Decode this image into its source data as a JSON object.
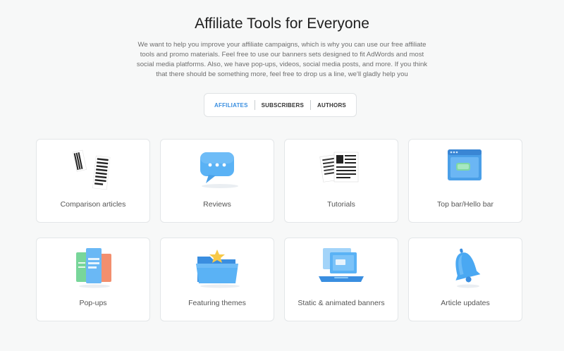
{
  "header": {
    "title": "Affiliate Tools for Everyone",
    "description": "We want to help you improve your affiliate campaigns, which is why you can use our free affiliate tools and promo materials. Feel free to use our banners sets designed to fit AdWords and most social media platforms. Also, we have pop-ups, videos, social media posts, and more. If you think that there should be something more, feel free to drop us a line, we'll gladly help you"
  },
  "tabs": [
    {
      "label": "AFFILIATES",
      "active": true
    },
    {
      "label": "SUBSCRIBERS",
      "active": false
    },
    {
      "label": "AUTHORS",
      "active": false
    }
  ],
  "colors": {
    "accent": "#3a8fe0",
    "icon_blue": "#4aa8f2",
    "background": "#f7f8f8"
  },
  "tools": [
    {
      "label": "Comparison articles",
      "icon": "comparison-articles-icon"
    },
    {
      "label": "Reviews",
      "icon": "chat-bubble-icon"
    },
    {
      "label": "Tutorials",
      "icon": "newspaper-icon"
    },
    {
      "label": "Top bar/Hello bar",
      "icon": "browser-window-icon"
    },
    {
      "label": "Pop-ups",
      "icon": "popup-cards-icon"
    },
    {
      "label": "Featuring themes",
      "icon": "folder-star-icon"
    },
    {
      "label": "Static & animated banners",
      "icon": "laptop-banner-icon"
    },
    {
      "label": "Article updates",
      "icon": "bell-icon"
    }
  ]
}
